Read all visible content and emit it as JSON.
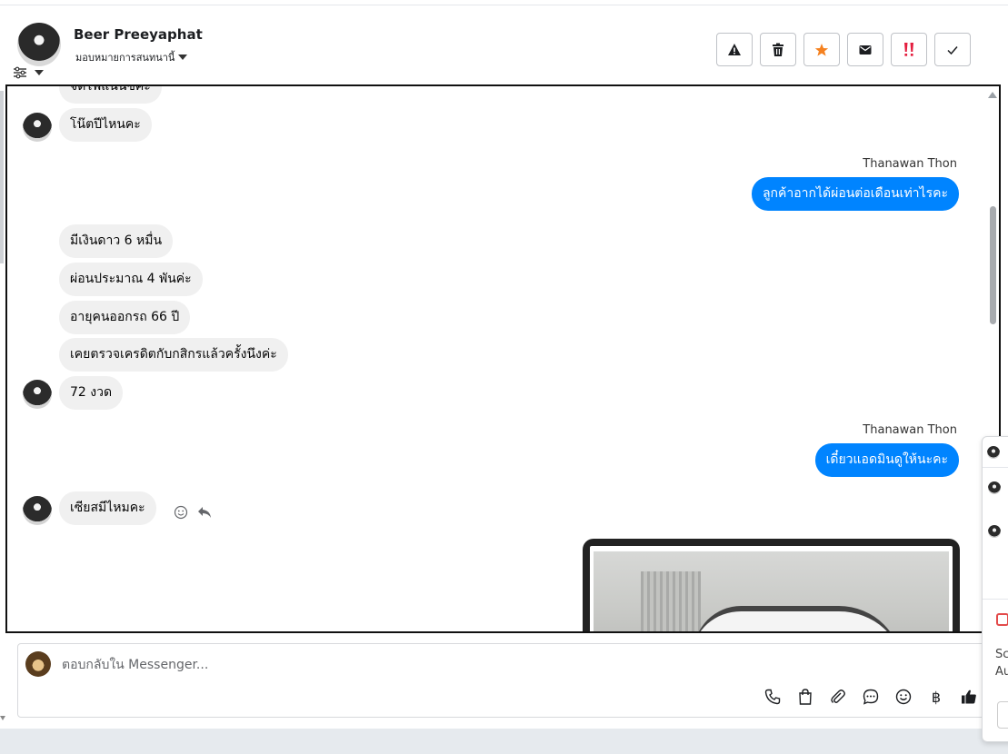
{
  "header": {
    "contact_name": "Beer Preeyaphat",
    "assign_label": "มอบหมายการสนทนานี้",
    "actions": [
      {
        "name": "report-button",
        "icon": "warning-icon"
      },
      {
        "name": "delete-button",
        "icon": "trash-icon"
      },
      {
        "name": "star-button",
        "icon": "star-icon"
      },
      {
        "name": "mark-unread-button",
        "icon": "envelope-icon"
      },
      {
        "name": "priority-button",
        "icon": "double-exclamation-icon"
      },
      {
        "name": "mark-done-button",
        "icon": "check-icon"
      }
    ]
  },
  "messages": {
    "partial_top": "จัดไฟแนนซ์คะ",
    "m1": "โน๊ตปีไหนคะ",
    "sender_1": "Thanawan Thon",
    "m2": "ลูกค้าอากได้ผ่อนต่อเดือนเท่าไรคะ",
    "m3": "มีเงินดาว 6 หมื่น",
    "m4": "ผ่อนประมาณ 4 พันค่ะ",
    "m5": "อายุคนออกรถ 66 ปี",
    "m6": "เคยตรวจเครดิตกับกสิกรแล้วครั้งนึงค่ะ",
    "m7": "72 งวด",
    "sender_2": "Thanawan Thon",
    "m8": "เดี๋ยวแอดมินดูให้นะคะ",
    "m9": "เซียสมีไหมคะ"
  },
  "composer": {
    "placeholder": "ตอบกลับใน Messenger...",
    "currency_symbol": "฿"
  },
  "popup": {
    "text_1": "Sc",
    "text_2": "Au"
  },
  "colors": {
    "outgoing_bubble": "#0084ff",
    "incoming_bubble": "#f0f0f0",
    "star": "#f5811f",
    "priority": "#e41e3f"
  }
}
